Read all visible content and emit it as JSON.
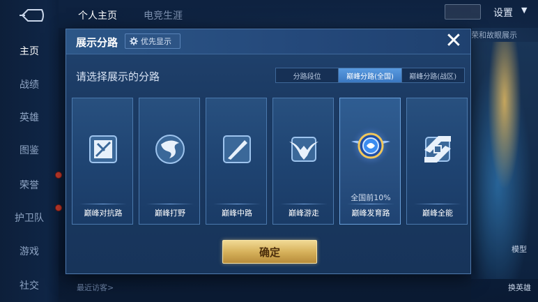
{
  "sidebar": {
    "items": [
      {
        "label": "主页"
      },
      {
        "label": "战绩"
      },
      {
        "label": "英雄"
      },
      {
        "label": "图鉴"
      },
      {
        "label": "荣誉"
      },
      {
        "label": "护卫队"
      },
      {
        "label": "游戏"
      },
      {
        "label": "社交"
      }
    ]
  },
  "topbar": {
    "tabs": [
      {
        "label": "个人主页"
      },
      {
        "label": "电竞生涯"
      }
    ],
    "settings_label": "设置",
    "right_text": "荣和故眼展示"
  },
  "scene": {
    "label_model": "模型",
    "label_switch": "换英雄"
  },
  "bottom": {
    "recent_label": "最近访客>"
  },
  "modal": {
    "title": "展示分路",
    "priority_label": "优先显示",
    "prompt": "请选择展示的分路",
    "segments": [
      {
        "label": "分路段位",
        "active": false
      },
      {
        "label": "巅峰分路(全国)",
        "active": true
      },
      {
        "label": "巅峰分路(战区)",
        "active": false
      }
    ],
    "cards": [
      {
        "label": "巅峰对抗路",
        "icon": "sword-shield-icon",
        "note": ""
      },
      {
        "label": "巅峰打野",
        "icon": "dragon-icon",
        "note": ""
      },
      {
        "label": "巅峰中路",
        "icon": "wand-icon",
        "note": ""
      },
      {
        "label": "巅峰游走",
        "icon": "wings-icon",
        "note": ""
      },
      {
        "label": "巅峰发育路",
        "icon": "glowing-emblem-icon",
        "note": "全国前10%"
      },
      {
        "label": "巅峰全能",
        "icon": "all-round-icon",
        "note": ""
      }
    ],
    "confirm_label": "确定"
  },
  "colors": {
    "accent_blue": "#3a78c2",
    "confirm_gold": "#d7b25c",
    "panel_bg": "#1b3a63"
  }
}
